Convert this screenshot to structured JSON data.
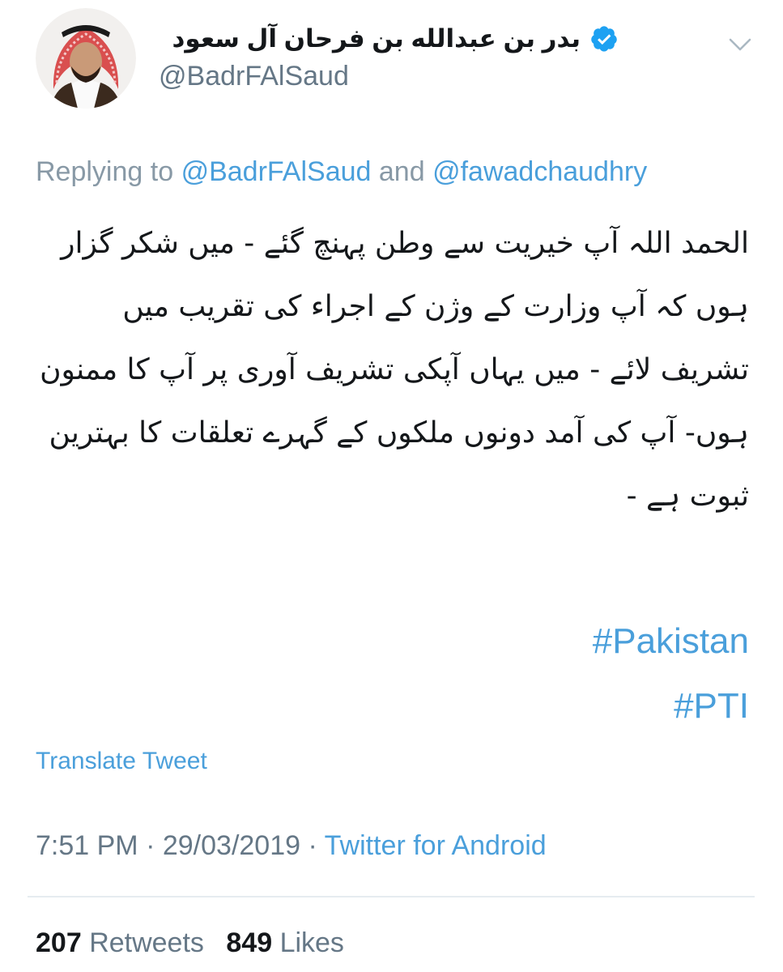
{
  "author": {
    "display_name": "بدر بن عبدالله بن فرحان آل سعود",
    "handle": "@BadrFAlSaud",
    "verified": true
  },
  "reply": {
    "prefix": "Replying to",
    "mention1": "@BadrFAlSaud",
    "joiner": "and",
    "mention2": "@fawadchaudhry"
  },
  "body": {
    "text": "الحمد اللہ آپ خیریت سے وطن پہنچ گئے - میں شکر گزار ہوں کہ آپ وزارت کے وژن کے اجراء کی تقریب میں تشریف لائے - میں یہاں آپکی تشریف آوری پر آپ کا ممنون ہوں- آپ کی آمد دونوں ملکوں کے گہرے تعلقات کا بہترین ثبوت ہے -",
    "hashtags": [
      "#Pakistan",
      "#PTI"
    ]
  },
  "translate_label": "Translate Tweet",
  "meta": {
    "time": "7:51 PM",
    "date": "29/03/2019",
    "separator": "·",
    "source": "Twitter for Android"
  },
  "stats": {
    "retweets_count": "207",
    "retweets_label": "Retweets",
    "likes_count": "849",
    "likes_label": "Likes"
  },
  "icons": {
    "verified": "verified-badge-icon",
    "caret": "chevron-down-icon"
  },
  "colors": {
    "link": "#4a9fdb",
    "secondary_text": "#657786",
    "verified": "#1da1f2"
  }
}
